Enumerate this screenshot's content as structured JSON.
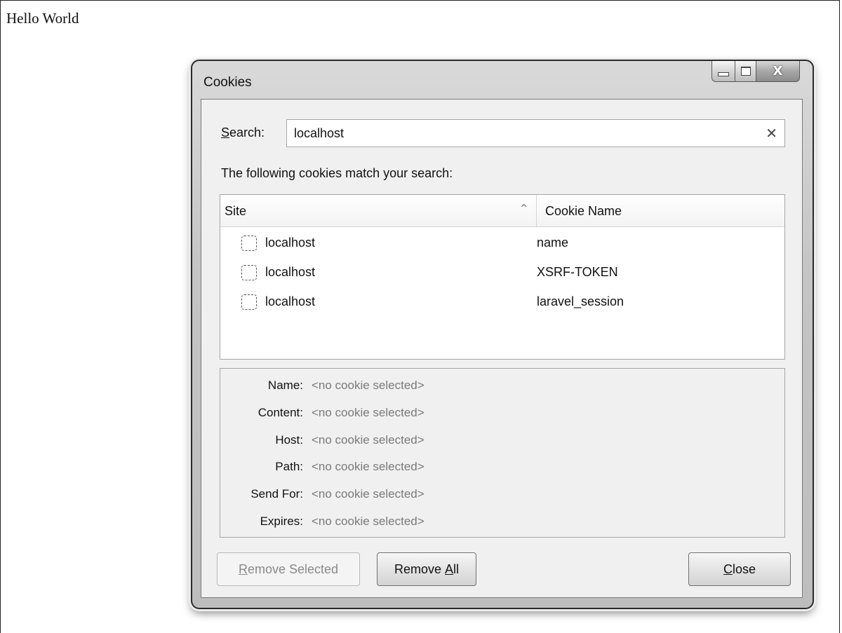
{
  "page": {
    "heading": "Hello World"
  },
  "dialog": {
    "title": "Cookies",
    "search": {
      "label_accel": "S",
      "label_rest": "earch:",
      "value": "localhost",
      "clear_icon": "close-icon"
    },
    "match_text": "The following cookies match your search:",
    "table": {
      "columns": [
        "Site",
        "Cookie Name"
      ],
      "sort_indicator": "^",
      "rows": [
        {
          "site": "localhost",
          "name": "name"
        },
        {
          "site": "localhost",
          "name": "XSRF-TOKEN"
        },
        {
          "site": "localhost",
          "name": "laravel_session"
        }
      ]
    },
    "details": [
      {
        "label": "Name:",
        "value": "<no cookie selected>"
      },
      {
        "label": "Content:",
        "value": "<no cookie selected>"
      },
      {
        "label": "Host:",
        "value": "<no cookie selected>"
      },
      {
        "label": "Path:",
        "value": "<no cookie selected>"
      },
      {
        "label": "Send For:",
        "value": "<no cookie selected>"
      },
      {
        "label": "Expires:",
        "value": "<no cookie selected>"
      }
    ],
    "buttons": {
      "remove_selected": {
        "accel": "R",
        "rest": "emove Selected"
      },
      "remove_all": {
        "pre": "Remove ",
        "accel": "A",
        "rest": "ll"
      },
      "close": {
        "accel": "C",
        "rest": "lose"
      }
    },
    "caption": {
      "close_glyph": "X"
    }
  }
}
